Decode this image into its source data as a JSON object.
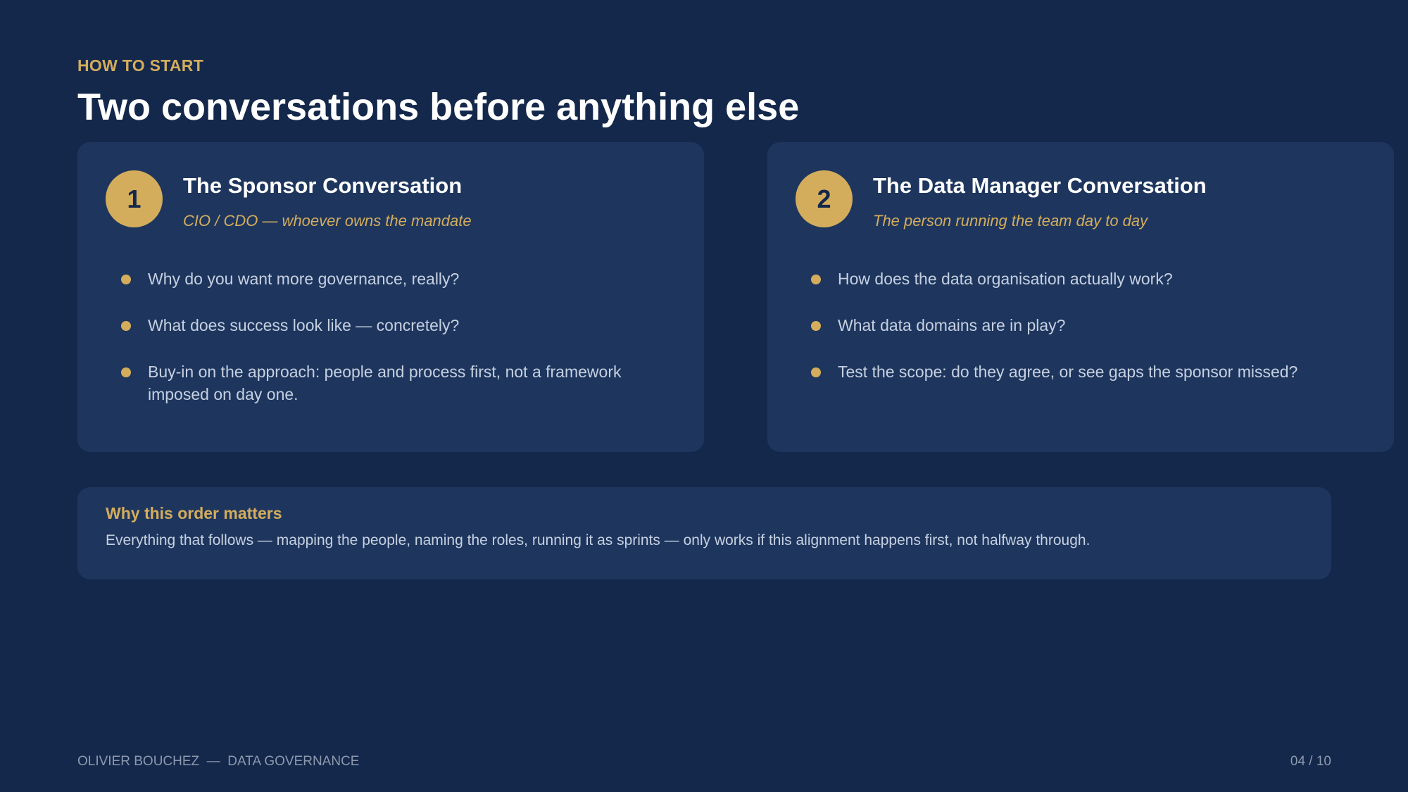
{
  "header": {
    "kicker": "HOW TO START",
    "title": "Two conversations before anything else"
  },
  "cards": [
    {
      "number": "1",
      "title": "The Sponsor Conversation",
      "subtitle": "CIO / CDO — whoever owns the mandate",
      "bullets": [
        "Why do you want more governance, really?",
        "What does success look like — concretely?",
        "Buy-in on the approach: people and process first, not a framework imposed on day one."
      ]
    },
    {
      "number": "2",
      "title": "The Data Manager Conversation",
      "subtitle": "The person running the team day to day",
      "bullets": [
        "How does the data organisation actually work?",
        "What data domains are in play?",
        "Test the scope: do they agree, or see gaps the sponsor missed?"
      ]
    }
  ],
  "callout": {
    "title": "Why this order matters",
    "body": "Everything that follows — mapping the people, naming the roles, running it as sprints — only works if this alignment happens first, not halfway through."
  },
  "footer": {
    "left": "OLIVIER BOUCHEZ  —  DATA GOVERNANCE",
    "page": "04 / 10"
  },
  "colors": {
    "background": "#14284b",
    "card": "#1e365e",
    "accent": "#d4ad5c",
    "text": "#c6d0e0",
    "muted": "#8d99ae"
  }
}
